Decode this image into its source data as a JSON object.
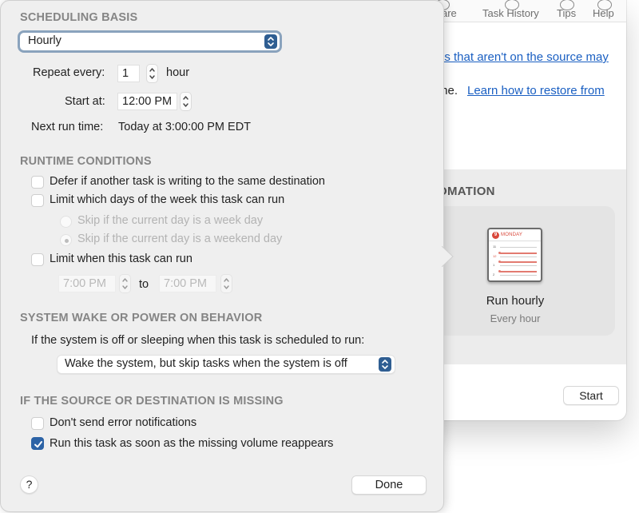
{
  "background_window": {
    "toolbar": {
      "items": [
        {
          "label": "are",
          "icon": "compare-icon"
        },
        {
          "label": "Task History",
          "icon": "task-history-icon"
        },
        {
          "label": "Tips",
          "icon": "tips-icon"
        },
        {
          "label": "Help",
          "icon": "help-icon"
        }
      ]
    },
    "body": {
      "link_1": "es that aren't on the source may",
      "text_2": "me.",
      "link_2": "Learn how to restore from"
    },
    "automation": {
      "section_title": "OMATION",
      "card": {
        "icon": "calendar-icon",
        "calendar_badge": "9",
        "calendar_day": "MONDAY",
        "calendar_hours": [
          "11",
          "12",
          "1",
          "2"
        ],
        "title": "Run hourly",
        "subtitle": "Every hour"
      }
    },
    "start_button": "Start"
  },
  "sheet": {
    "scheduling_basis": {
      "title": "SCHEDULING BASIS",
      "basis_popup": {
        "value": "Hourly"
      },
      "repeat_every": {
        "label": "Repeat every:",
        "value": "1",
        "unit": "hour"
      },
      "start_at": {
        "label": "Start at:",
        "value": "12:00 PM"
      },
      "next_run": {
        "label": "Next run time:",
        "value": "Today at 3:00:00 PM EDT"
      }
    },
    "runtime_conditions": {
      "title": "RUNTIME CONDITIONS",
      "defer": {
        "label": "Defer if another task is writing to the same destination",
        "checked": false
      },
      "limit_days": {
        "label": "Limit which days of the week this task can run",
        "checked": false
      },
      "skip_weekday": {
        "label": "Skip if the current day is a week day",
        "selected": false,
        "enabled": false
      },
      "skip_weekend": {
        "label": "Skip if the current day is a weekend day",
        "selected": true,
        "enabled": false
      },
      "limit_time": {
        "label": "Limit when this task can run",
        "checked": false
      },
      "time_from": "7:00 PM",
      "time_to_label": "to",
      "time_to": "7:00 PM"
    },
    "wake_behavior": {
      "title": "SYSTEM WAKE OR POWER ON BEHAVIOR",
      "prompt": "If the system is off or sleeping when this task is scheduled to run:",
      "popup_value": "Wake the system, but skip tasks when the system is off"
    },
    "missing": {
      "title": "IF THE SOURCE OR DESTINATION IS MISSING",
      "no_errors": {
        "label": "Don't send error notifications",
        "checked": false
      },
      "run_on_reappear": {
        "label": "Run this task as soon as the missing volume reappears",
        "checked": true
      }
    },
    "help_button": "?",
    "done_button": "Done"
  },
  "colors": {
    "accent": "#2c63a6",
    "popup_accent": "#2f5e92",
    "link": "#1a5fc2",
    "calendar_red": "#d9483b",
    "section_title": "#858585"
  }
}
